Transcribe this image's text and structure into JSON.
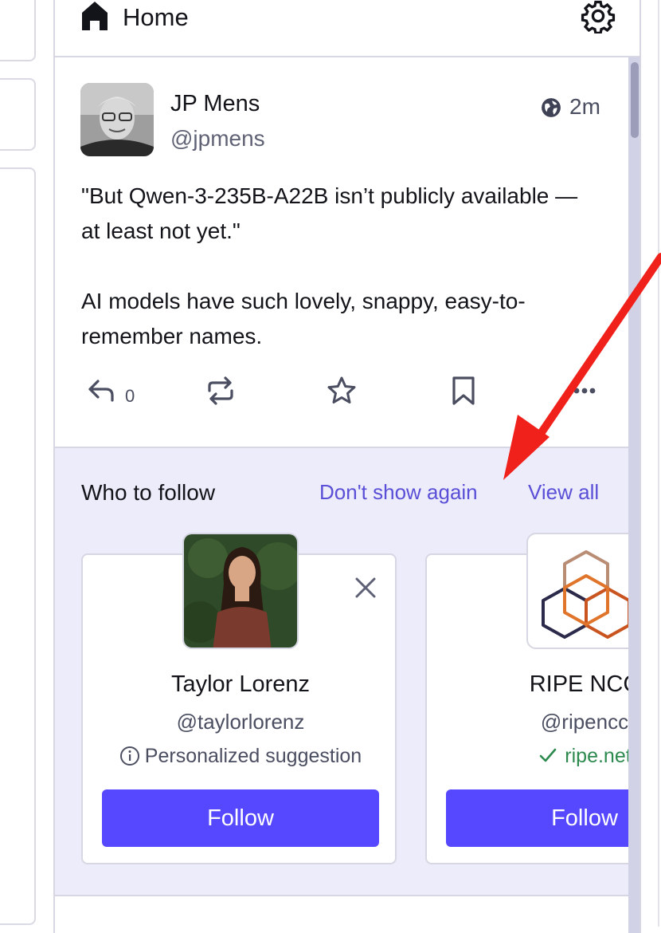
{
  "header": {
    "title": "Home",
    "icon": "home-icon",
    "settings_icon": "gear-icon"
  },
  "post": {
    "display_name": "JP Mens",
    "handle": "@jpmens",
    "visibility_icon": "globe-icon",
    "time": "2m",
    "paragraphs": [
      "\"But Qwen-3-235B-A22B isn’t publicly available — at least not yet.\"",
      "AI models have such lovely, snappy, easy-to-remember names."
    ],
    "reply_count": "0",
    "action_icons": [
      "reply-icon",
      "boost-icon",
      "star-icon",
      "bookmark-icon",
      "more-icon"
    ]
  },
  "who_to_follow": {
    "title": "Who to follow",
    "dont_show_label": "Don't show again",
    "view_all_label": "View all",
    "cards": [
      {
        "name": "Taylor Lorenz",
        "handle": "@taylorlorenz",
        "reason": "Personalized suggestion",
        "reason_icon": "info-icon",
        "button": "Follow"
      },
      {
        "name": "RIPE NCC",
        "handle": "@ripencc",
        "reason": "ripe.net",
        "reason_icon": "check-icon",
        "button": "Follow"
      }
    ]
  },
  "colors": {
    "accent": "#5648ff",
    "link": "#5a4fd6",
    "annotation_arrow": "#f0201b",
    "panel": "#ececfb"
  }
}
